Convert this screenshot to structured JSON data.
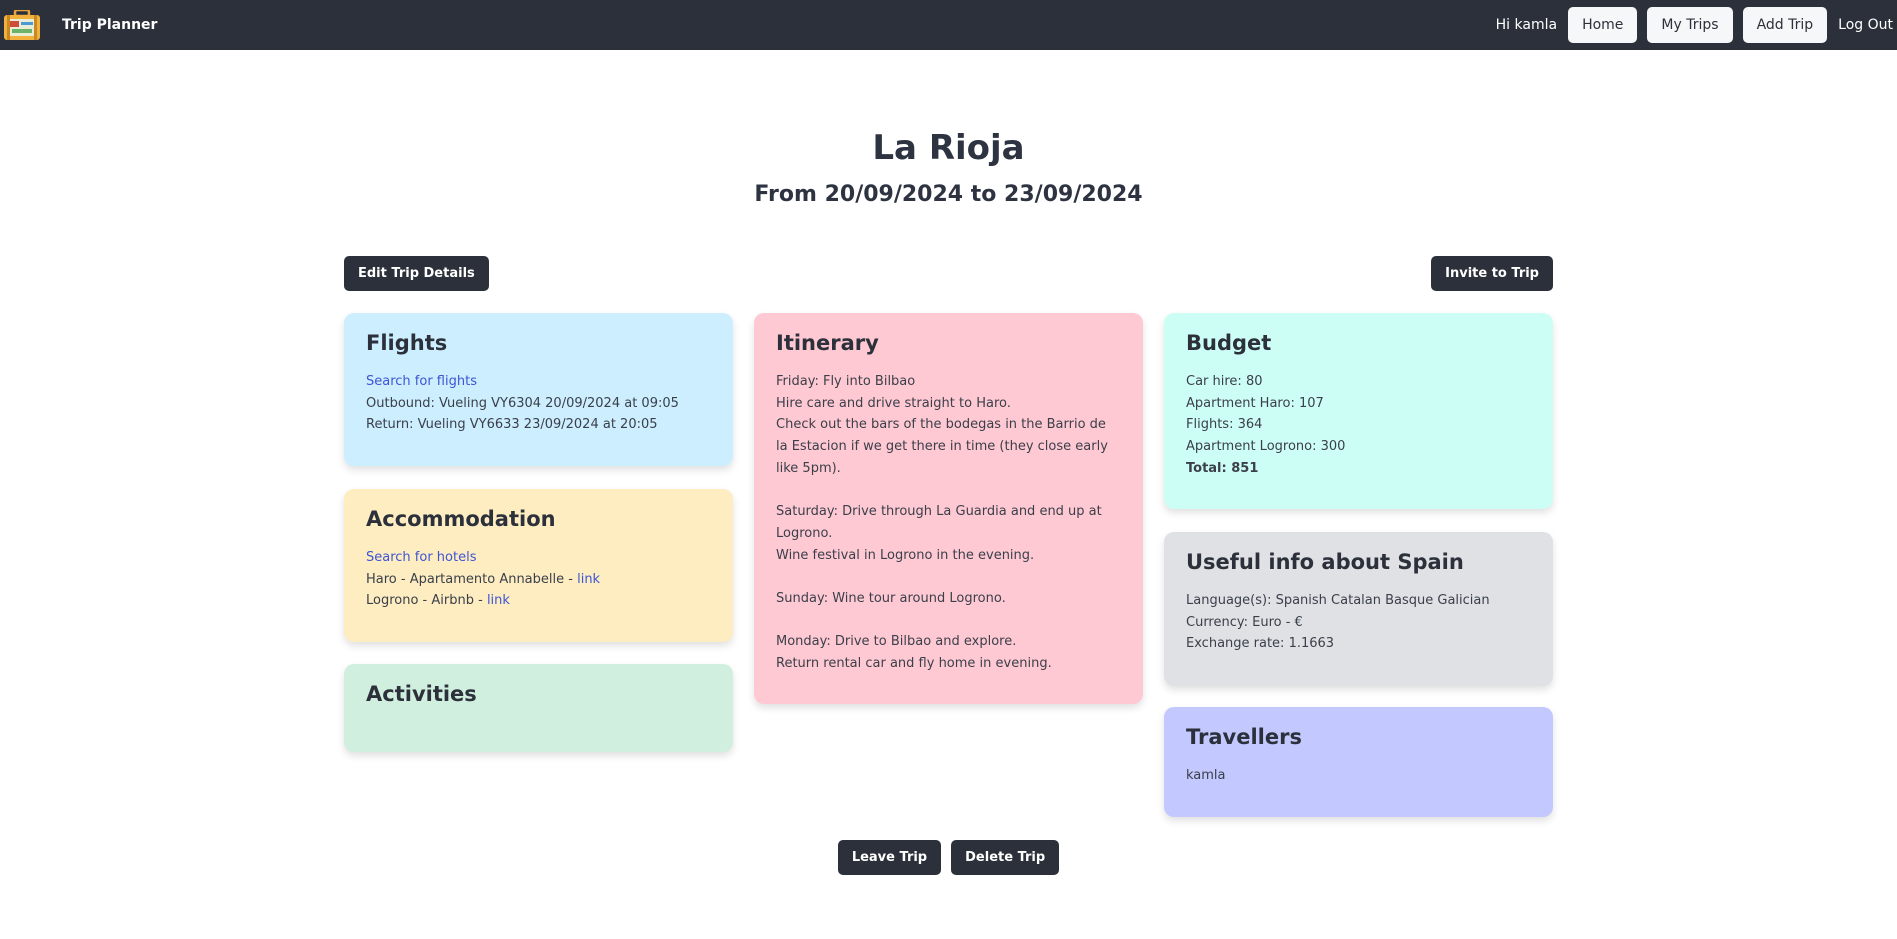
{
  "nav": {
    "brand": "Trip Planner",
    "greeting": "Hi kamla",
    "links": [
      "Home",
      "My Trips",
      "Add Trip"
    ],
    "logout": "Log Out"
  },
  "trip": {
    "title": "La Rioja",
    "dates": "From 20/09/2024 to 23/09/2024"
  },
  "actions": {
    "edit": "Edit Trip Details",
    "invite": "Invite to Trip",
    "leave": "Leave Trip",
    "delete": "Delete Trip"
  },
  "flights": {
    "title": "Flights",
    "search": "Search for flights",
    "outbound": "Outbound: Vueling VY6304 20/09/2024 at 09:05",
    "return": "Return: Vueling VY6633 23/09/2024 at 20:05"
  },
  "accommodation": {
    "title": "Accommodation",
    "search": "Search for hotels",
    "items": [
      {
        "text": "Haro - Apartamento Annabelle - ",
        "link": "link"
      },
      {
        "text": "Logrono - Airbnb - ",
        "link": "link"
      }
    ]
  },
  "activities": {
    "title": "Activities"
  },
  "itinerary": {
    "title": "Itinerary",
    "lines": [
      "Friday: Fly into Bilbao",
      "Hire care and drive straight to Haro.",
      "Check out the bars of the bodegas in the Barrio de la Estacion if we get there in time (they close early like 5pm).",
      "",
      "Saturday: Drive through La Guardia and end up at Logrono.",
      "Wine festival in Logrono in the evening.",
      "",
      "Sunday: Wine tour around Logrono.",
      "",
      "Monday: Drive to Bilbao and explore.",
      "Return rental car and fly home in evening."
    ]
  },
  "budget": {
    "title": "Budget",
    "items": [
      "Car hire: 80",
      "Apartment Haro: 107",
      "Flights: 364",
      "Apartment Logrono: 300"
    ],
    "total": "Total: 851"
  },
  "info": {
    "title": "Useful info about Spain",
    "language": "Language(s): Spanish Catalan Basque Galician",
    "currency": "Currency: Euro - €",
    "rate": "Exchange rate: 1.1663"
  },
  "travellers": {
    "title": "Travellers",
    "names": [
      "kamla"
    ]
  }
}
